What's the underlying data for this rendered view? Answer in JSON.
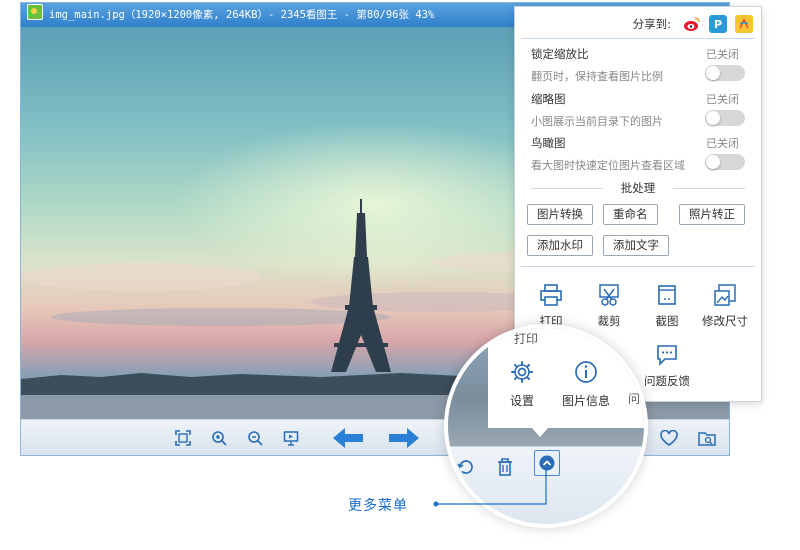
{
  "window": {
    "title": "img_main.jpg（1920×1200像素, 264KB）- 2345看图王 - 第80/96张 43%"
  },
  "panel": {
    "share_label": "分享到:",
    "share_icons": [
      "weibo-icon",
      "qzone-icon",
      "tencent-weibo-icon"
    ],
    "options": [
      {
        "title": "锁定缩放比",
        "state": "已关闭",
        "desc": "翻页时，保持查看图片比例"
      },
      {
        "title": "缩略图",
        "state": "已关闭",
        "desc": "小图展示当前目录下的图片"
      },
      {
        "title": "鸟瞰图",
        "state": "已关闭",
        "desc": "看大图时快速定位图片查看区域"
      }
    ],
    "batch_title": "批处理",
    "batch_buttons": [
      "图片转换",
      "重命名",
      "照片转正",
      "添加水印",
      "添加文字"
    ],
    "tools": [
      {
        "label": "打印",
        "icon": "printer-icon"
      },
      {
        "label": "裁剪",
        "icon": "crop-icon"
      },
      {
        "label": "截图",
        "icon": "screenshot-icon"
      },
      {
        "label": "修改尺寸",
        "icon": "resize-icon"
      },
      {
        "label": "问题反馈",
        "icon": "feedback-icon"
      }
    ]
  },
  "magnifier": {
    "ghost_print": "打印",
    "ghost_q": "问",
    "tools": [
      {
        "label": "设置",
        "icon": "gear-icon"
      },
      {
        "label": "图片信息",
        "icon": "info-icon"
      }
    ]
  },
  "callout": {
    "label": "更多菜单"
  },
  "colors": {
    "accent": "#1a6fc9",
    "titlebar": "#2f7fca",
    "icon_blue": "#2a6db6"
  }
}
